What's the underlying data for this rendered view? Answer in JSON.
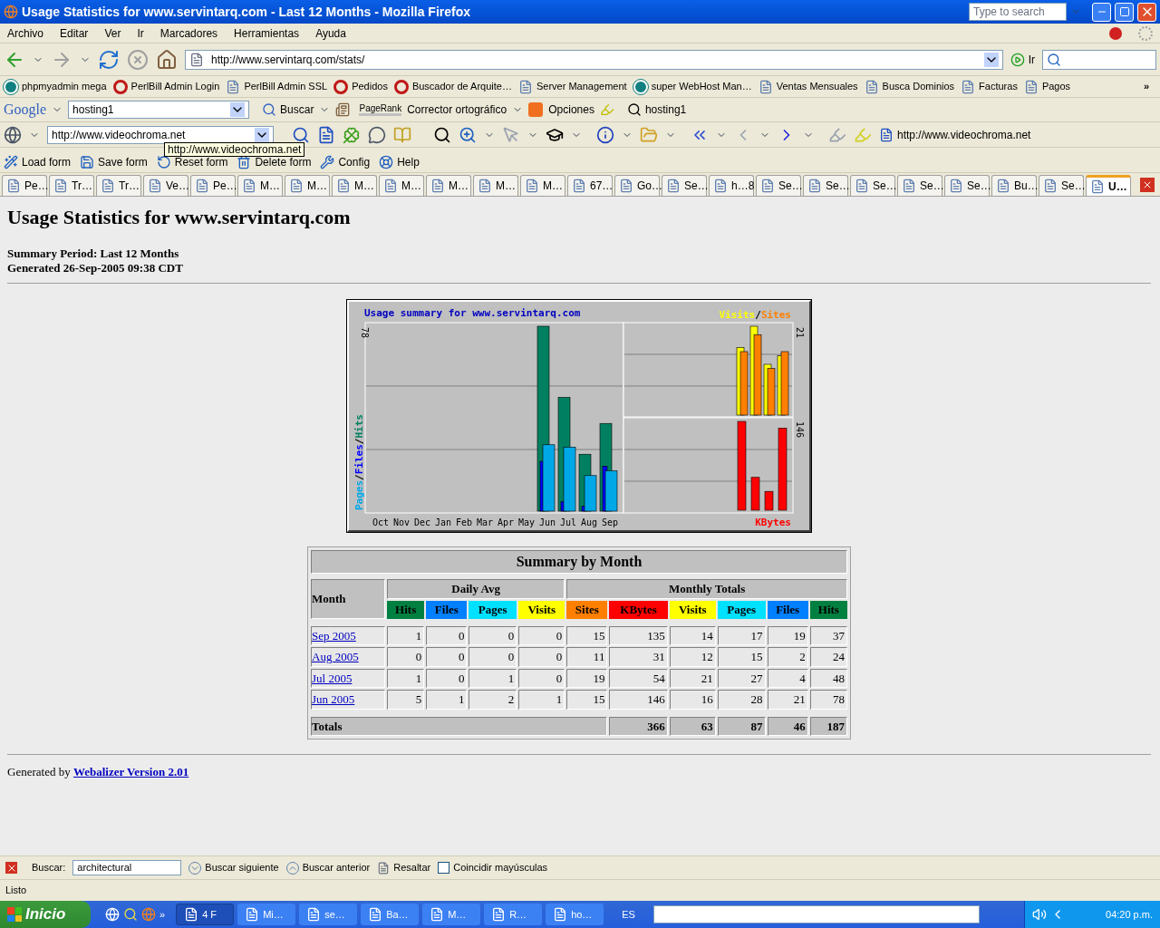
{
  "window": {
    "title": "Usage Statistics for www.servintarq.com - Last 12 Months - Mozilla Firefox",
    "search_placeholder": "Type to search"
  },
  "menu": [
    "Archivo",
    "Editar",
    "Ver",
    "Ir",
    "Marcadores",
    "Herramientas",
    "Ayuda"
  ],
  "address": {
    "url": "http://www.servintarq.com/stats/",
    "go": "Ir"
  },
  "bookmarks": [
    {
      "label": "phpmyadmin mega",
      "kind": "logo"
    },
    {
      "label": "PerlBill Admin Login",
      "kind": "q"
    },
    {
      "label": "PerlBill Admin SSL",
      "kind": "page"
    },
    {
      "label": "Pedidos",
      "kind": "q"
    },
    {
      "label": "Buscador de Arquite…",
      "kind": "q"
    },
    {
      "label": "Server Management",
      "kind": "page"
    },
    {
      "label": "super WebHost Man…",
      "kind": "logo"
    },
    {
      "label": "Ventas Mensuales",
      "kind": "page"
    },
    {
      "label": "Busca Dominios",
      "kind": "page"
    },
    {
      "label": "Facturas",
      "kind": "page"
    },
    {
      "label": "Pagos",
      "kind": "page"
    }
  ],
  "bookmarks_more": "»",
  "google_toolbar": {
    "brand": "Google",
    "query": "hosting1",
    "search": "Buscar",
    "pagerank": "PageRank",
    "spell": "Corrector ortográfico",
    "options": "Opciones",
    "saved": "hosting1"
  },
  "link_toolbar": {
    "url": "http://www.videochroma.net",
    "link": "http://www.videochroma.net"
  },
  "tooltip": "http://www.videochroma.net",
  "form_toolbar": [
    "Load form",
    "Save form",
    "Reset form",
    "Delete form",
    "Config",
    "Help"
  ],
  "tabs": [
    {
      "label": "Pe…",
      "selected": false
    },
    {
      "label": "Tr…",
      "selected": false
    },
    {
      "label": "Tr…",
      "selected": false
    },
    {
      "label": "Ve…",
      "selected": false
    },
    {
      "label": "Pe…",
      "selected": false
    },
    {
      "label": "M…",
      "selected": false
    },
    {
      "label": "M…",
      "selected": false
    },
    {
      "label": "M…",
      "selected": false
    },
    {
      "label": "M…",
      "selected": false
    },
    {
      "label": "M…",
      "selected": false
    },
    {
      "label": "M…",
      "selected": false
    },
    {
      "label": "M…",
      "selected": false
    },
    {
      "label": "67…",
      "selected": false
    },
    {
      "label": "Go…",
      "selected": false
    },
    {
      "label": "Se…",
      "selected": false
    },
    {
      "label": "h…8",
      "selected": false
    },
    {
      "label": "Se…",
      "selected": false
    },
    {
      "label": "Se…",
      "selected": false
    },
    {
      "label": "Se…",
      "selected": false
    },
    {
      "label": "Se…",
      "selected": false
    },
    {
      "label": "Se…",
      "selected": false
    },
    {
      "label": "Bu…",
      "selected": false
    },
    {
      "label": "Se…",
      "selected": false
    },
    {
      "label": "U…",
      "selected": true
    }
  ],
  "page": {
    "heading": "Usage Statistics for www.servintarq.com",
    "summary_lines": [
      "Summary Period: Last 12 Months",
      "Generated 26-Sep-2005 09:38 CDT"
    ],
    "chart": {
      "title": "Usage summary for www.servintarq.com",
      "legend_separator": "/",
      "left_legend": [
        {
          "text": "Pages",
          "color": "#00a8e8"
        },
        {
          "text": "Files",
          "color": "#0000ff"
        },
        {
          "text": "Hits",
          "color": "#008060"
        }
      ],
      "right_legend": [
        {
          "text": "Visits",
          "color": "#ffff00"
        },
        {
          "text": "Sites",
          "color": "#ff8000"
        }
      ],
      "kbytes_label": {
        "text": "KBytes",
        "color": "#ff0000"
      },
      "hits_max": "78",
      "visits_max": "21",
      "kbytes_max": "146",
      "months": [
        "Oct",
        "Nov",
        "Dec",
        "Jan",
        "Feb",
        "Mar",
        "Apr",
        "May",
        "Jun",
        "Jul",
        "Aug",
        "Sep"
      ]
    },
    "table": {
      "title": "Summary by Month",
      "month_header": "Month",
      "groups": [
        {
          "label": "Daily Avg"
        },
        {
          "label": "Monthly Totals"
        }
      ],
      "columns": [
        {
          "label": "Hits",
          "color": "#008040"
        },
        {
          "label": "Files",
          "color": "#0080ff"
        },
        {
          "label": "Pages",
          "color": "#00e0ff"
        },
        {
          "label": "Visits",
          "color": "#ffff00"
        },
        {
          "label": "Sites",
          "color": "#ff8000"
        },
        {
          "label": "KBytes",
          "color": "#ff0000"
        },
        {
          "label": "Visits",
          "color": "#ffff00"
        },
        {
          "label": "Pages",
          "color": "#00e0ff"
        },
        {
          "label": "Files",
          "color": "#0080ff"
        },
        {
          "label": "Hits",
          "color": "#008040"
        }
      ],
      "rows": [
        {
          "month": "Sep 2005",
          "cells": [
            "1",
            "0",
            "0",
            "0",
            "15",
            "135",
            "14",
            "17",
            "19",
            "37"
          ]
        },
        {
          "month": "Aug 2005",
          "cells": [
            "0",
            "0",
            "0",
            "0",
            "11",
            "31",
            "12",
            "15",
            "2",
            "24"
          ]
        },
        {
          "month": "Jul 2005",
          "cells": [
            "1",
            "0",
            "1",
            "0",
            "19",
            "54",
            "21",
            "27",
            "4",
            "48"
          ]
        },
        {
          "month": "Jun 2005",
          "cells": [
            "5",
            "1",
            "2",
            "1",
            "15",
            "146",
            "16",
            "28",
            "21",
            "78"
          ]
        }
      ],
      "totals": {
        "label": "Totals",
        "cells": [
          "366",
          "63",
          "87",
          "46",
          "187"
        ]
      }
    },
    "footer": {
      "prefix": "Generated by",
      "link": "Webalizer Version 2.01"
    }
  },
  "find_bar": {
    "label": "Buscar:",
    "value": "architectural",
    "next": "Buscar siguiente",
    "previous": "Buscar anterior",
    "highlight": "Resaltar",
    "match_case": {
      "label": "Coincidir mayúsculas",
      "checked": false
    }
  },
  "status": "Listo",
  "taskbar": {
    "start": "Inicio",
    "more": "»",
    "items": [
      {
        "label": "4 F",
        "selected": true
      },
      {
        "label": "Mi…",
        "selected": false
      },
      {
        "label": "se…",
        "selected": false
      },
      {
        "label": "Ba…",
        "selected": false
      },
      {
        "label": "M…",
        "selected": false
      },
      {
        "label": "R…",
        "selected": false
      },
      {
        "label": "ho…",
        "selected": false
      }
    ],
    "lang": "ES",
    "clock": "04:20 p.m."
  }
}
